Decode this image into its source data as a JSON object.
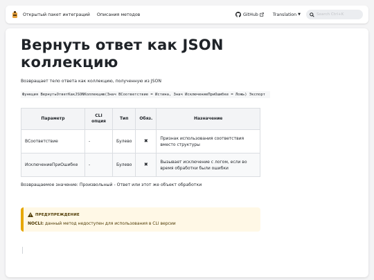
{
  "nav": {
    "link1": "Открытый пакет интеграций",
    "link2": "Описания методов",
    "github": "GitHub",
    "translation": "Translation",
    "search_placeholder": "Search Ctrl+K"
  },
  "page": {
    "title": "Вернуть ответ как JSON коллекцию",
    "description": "Возвращает тело ответа как коллекцию, полученную из JSON",
    "signature": "Функция ВернутьОтветКакJSONКоллекцию(Знач ВСоответствие = Истина, Знач ИсключениеПриОшибке = Ложь) Экспорт",
    "returns": "Возвращаемое значение: Произвольный - Ответ или этот же объект обработки"
  },
  "table": {
    "headers": [
      "Параметр",
      "CLI опция",
      "Тип",
      "Обяз.",
      "Назначение"
    ],
    "rows": [
      [
        "ВСоответствие",
        "-",
        "Булево",
        "✖",
        "Признак использования соответствия вместо структуры"
      ],
      [
        "ИсключениеПриОшибке",
        "-",
        "Булево",
        "✖",
        "Вызывает исключение с логом, если во время обработки были ошибки"
      ]
    ]
  },
  "warning": {
    "title": "ПРЕДУПРЕЖДЕНИЕ",
    "label": "NOCLI:",
    "text": " данный метод недоступен для использования в CLI версии"
  },
  "colors": {
    "accent": "#e6a700",
    "warning_bg": "#fff8e6",
    "header_bg": "#f3f4f6"
  },
  "icons": [
    "logo-icon",
    "github-icon",
    "external-link-icon",
    "chevron-down-icon",
    "search-icon",
    "warning-icon"
  ]
}
